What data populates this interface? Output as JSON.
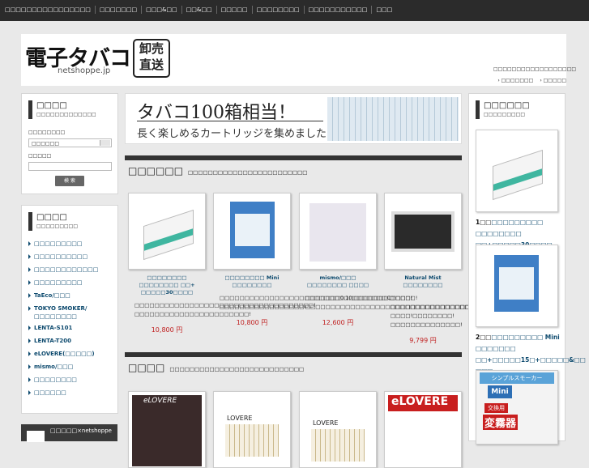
{
  "topnav": {
    "items": [
      "□□□□□□□□□□□□□□□□",
      "□□□□□□□",
      "□□□&□□",
      "□□&□□",
      "□□□□□",
      "□□□□□□□□",
      "□□□□□□□□□□□",
      "□□□"
    ]
  },
  "header": {
    "logo_text": "電子タバコ",
    "logo_stamp": "卸売直送",
    "logo_domain": "netshoppe.jp",
    "tagline": "□□□□□□□□□□□□□□□□□□",
    "links": [
      "□□□□□□□",
      "□□□□□"
    ]
  },
  "search": {
    "title": "□□□□",
    "subtitle": "□□□□□□□□□□□□□",
    "category_label": "□□□□□□□□",
    "category_value": "□□□□□□",
    "keyword_label": "□□□□□",
    "keyword_value": "",
    "button": "検 索"
  },
  "categories": {
    "title": "□□□□",
    "subtitle": "□□□□□□□□□",
    "items": [
      "□□□□□□□□□",
      "□□□□□□□□□□",
      "□□□□□□□□□□□□",
      "□□□□□□□□□",
      "TaEco/□□□",
      "TOKYO SMOKER/□□□□□□□□",
      "LENTA-S101",
      "LENTA-T200",
      "eLOVERE(□□□□□)",
      "mismo/□□□",
      "□□□□□□□□",
      "□□□□□□"
    ]
  },
  "facebook": {
    "text": "□□□□□×netshoppe"
  },
  "banner": {
    "line1": "タバコ100箱相当！",
    "line2": "長く楽しめるカートリッジを集めました"
  },
  "section1": {
    "title": "□□□□□□",
    "subtitle": "□□□□□□□□□□□□□□□□□□□□□□□□",
    "products": [
      {
        "name": "□□□□□□□□ □□□□□□□□ □□+ □□□□□30□□□□",
        "desc": "□□□□□□□□□□□□□□□□□□□□□□□□□□□□□□□□□□□□!□□□□□□□□□□□□□□□□□□□□□□□!",
        "price": "10,800 円"
      },
      {
        "name": "□□□□□□□□ Mini □□□□□□□□",
        "desc": "□□□□□□□□□□□□□□□□□□□□□□□□□□□□□□□□□□□!□□□□□□□□□□□□□□□□□!",
        "price": "10,800 円"
      },
      {
        "name": "mismo/□□□ □□□□□□□□ □□□□",
        "desc": "□□□□□□□0.10□□□□□□□C□□□□□!□□□□□□□□□□□□□□□□□□□□□□□□□□□□□□□□□□",
        "price": "12,600 円"
      },
      {
        "name": "Natural Mist □□□□□□□□",
        "desc": "□□□□!□□□□□□□□□□□□□□□□□□□!□□□□!□□□□□□□□!□□□□□□□□□□□□□□!",
        "price": "9,799 円"
      }
    ]
  },
  "section2": {
    "title": "□□□□",
    "subtitle": "□□□□□□□□□□□□□□□□□□□□□□□□□□□",
    "products": [
      {
        "img_text": "eLOVERE"
      },
      {
        "img_text": "LOVERE"
      },
      {
        "img_text": "LOVERE"
      },
      {
        "img_text": "eLOVERE"
      }
    ]
  },
  "ranking": {
    "title": "□□□□□□",
    "subtitle": "□□□□□□□□□",
    "items": [
      {
        "rank": "1□□",
        "text": "□□□□□□□□□ □□□□□□□□ □□+□□□□□30□□□□"
      },
      {
        "rank": "2□□",
        "text": "□□□□□□□□□ Mini □□□□□□□ □□+□□□□□15□+□□□□□&□□ □□□"
      }
    ],
    "ad_top": "シンプルスモーカー",
    "ad_mini": "Mini",
    "ad_small": "交換用",
    "ad_big": "変霧器"
  }
}
